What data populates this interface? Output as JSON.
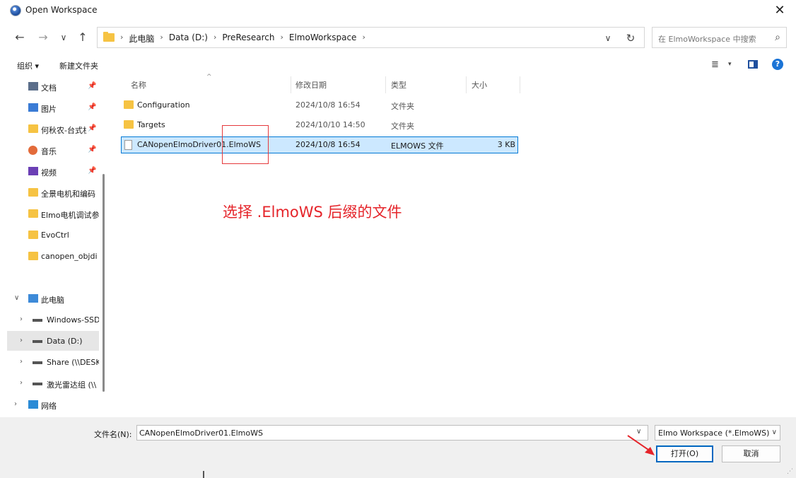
{
  "window": {
    "title": "Open Workspace",
    "close": "✕"
  },
  "nav": {
    "back": "←",
    "forward": "→",
    "recent": "∨",
    "up": "↑",
    "breadcrumbs": [
      "此电脑",
      "Data (D:)",
      "PreResearch",
      "ElmoWorkspace"
    ],
    "separator": "›",
    "dropdown": "∨",
    "refresh": "↻",
    "search_placeholder": "在 ElmoWorkspace 中搜索",
    "search_icon": "⌕"
  },
  "toolbar": {
    "organize": "组织 ▾",
    "new_folder": "新建文件夹",
    "view_icon": "≣",
    "view_dropdown": "▾",
    "help": "?"
  },
  "sidebar": {
    "pin_glyph": "📌",
    "quick": [
      {
        "label": "文档",
        "icon": "document-icon"
      },
      {
        "label": "图片",
        "icon": "pictures-icon"
      },
      {
        "label": "何秋农-台式机",
        "icon": "folder-icon"
      },
      {
        "label": "音乐",
        "icon": "music-icon"
      },
      {
        "label": "视频",
        "icon": "video-icon"
      },
      {
        "label": "全景电机和编码",
        "icon": "folder-icon"
      },
      {
        "label": "Elmo电机调试参",
        "icon": "folder-icon"
      },
      {
        "label": "EvoCtrl",
        "icon": "folder-icon"
      },
      {
        "label": "canopen_objdi",
        "icon": "folder-icon"
      }
    ],
    "this_pc": "此电脑",
    "drives": [
      {
        "label": "Windows-SSD"
      },
      {
        "label": "Data (D:)"
      },
      {
        "label": "Share (\\\\DESK"
      },
      {
        "label": "激光雷达组 (\\\\"
      }
    ],
    "network": "网络",
    "expand_open": "∨",
    "expand_closed": "›"
  },
  "columns": {
    "name": "名称",
    "modified": "修改日期",
    "type": "类型",
    "size": "大小",
    "sort_indicator": "^"
  },
  "files": [
    {
      "name": "Configuration",
      "modified": "2024/10/8 16:54",
      "type": "文件夹",
      "size": "",
      "kind": "folder"
    },
    {
      "name": "Targets",
      "modified": "2024/10/10 14:50",
      "type": "文件夹",
      "size": "",
      "kind": "folder"
    },
    {
      "name": "CANopenElmoDriver01.ElmoWS",
      "modified": "2024/10/8 16:54",
      "type": "ELMOWS 文件",
      "size": "3 KB",
      "kind": "file"
    }
  ],
  "annotation": "选择 .ElmoWS 后缀的文件",
  "bottom": {
    "filename_label": "文件名(N):",
    "filename_value": "CANopenElmoDriver01.ElmoWS",
    "dropdown": "∨",
    "filetype": "Elmo Workspace (*.ElmoWS)",
    "open_button": "打开(O)",
    "cancel_button": "取消"
  },
  "colors": {
    "accent": "#0078d4",
    "annotation": "#e5242a",
    "folder": "#f6c343",
    "selected_row": "#cce8ff"
  }
}
